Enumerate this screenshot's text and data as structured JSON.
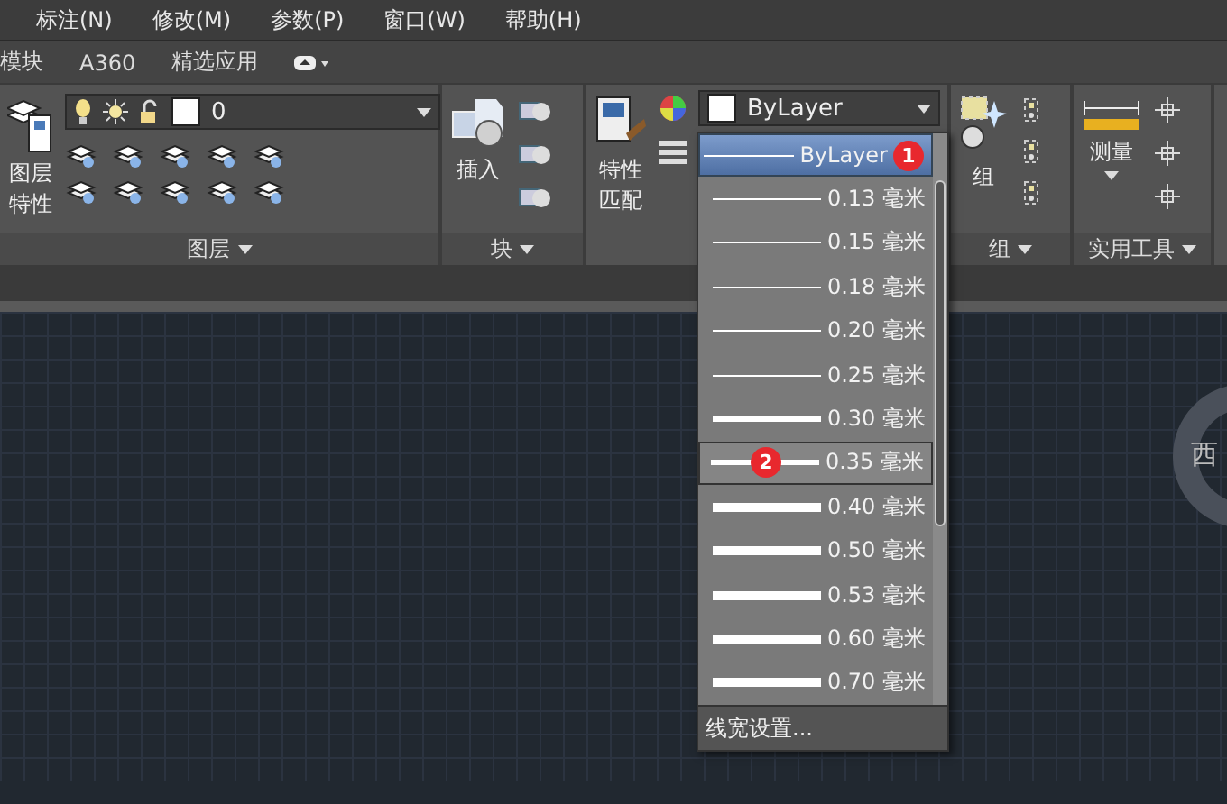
{
  "menu_bar": [
    "标注(N)",
    "修改(M)",
    "参数(P)",
    "窗口(W)",
    "帮助(H)"
  ],
  "tabs": [
    {
      "label": "模块",
      "selected": false
    },
    {
      "label": "A360",
      "selected": false
    },
    {
      "label": "精选应用",
      "selected": false
    }
  ],
  "layer_panel": {
    "button_lines": [
      "图层",
      "特性"
    ],
    "layer_combo": "0",
    "title": "图层"
  },
  "block_panel": {
    "button": "插入",
    "title": "块"
  },
  "properties_panel": {
    "button_lines": [
      "特性",
      "匹配"
    ],
    "lineweight_combo": "ByLayer"
  },
  "group_panel": {
    "button": "组",
    "title": "组"
  },
  "utilities_panel": {
    "button": "测量",
    "title": "实用工具"
  },
  "lineweight_menu": {
    "items": [
      {
        "label": "ByLayer",
        "kind": "hairline",
        "selected": true,
        "focused": false,
        "badge": "1"
      },
      {
        "label": "0.13 毫米",
        "kind": "hairline",
        "selected": false,
        "focused": false
      },
      {
        "label": "0.15 毫米",
        "kind": "hairline",
        "selected": false,
        "focused": false
      },
      {
        "label": "0.18 毫米",
        "kind": "hairline",
        "selected": false,
        "focused": false
      },
      {
        "label": "0.20 毫米",
        "kind": "hairline",
        "selected": false,
        "focused": false
      },
      {
        "label": "0.25 毫米",
        "kind": "hairline",
        "selected": false,
        "focused": false
      },
      {
        "label": "0.30 毫米",
        "kind": "medium",
        "selected": false,
        "focused": false
      },
      {
        "label": "0.35 毫米",
        "kind": "medium",
        "selected": false,
        "focused": true,
        "badge": "2"
      },
      {
        "label": "0.40 毫米",
        "kind": "heavy",
        "selected": false,
        "focused": false
      },
      {
        "label": "0.50 毫米",
        "kind": "heavy",
        "selected": false,
        "focused": false
      },
      {
        "label": "0.53 毫米",
        "kind": "heavy",
        "selected": false,
        "focused": false
      },
      {
        "label": "0.60 毫米",
        "kind": "heavy",
        "selected": false,
        "focused": false
      },
      {
        "label": "0.70 毫米",
        "kind": "heavy",
        "selected": false,
        "focused": false
      }
    ],
    "footer": "线宽设置..."
  },
  "viewcube": {
    "label": "西"
  }
}
